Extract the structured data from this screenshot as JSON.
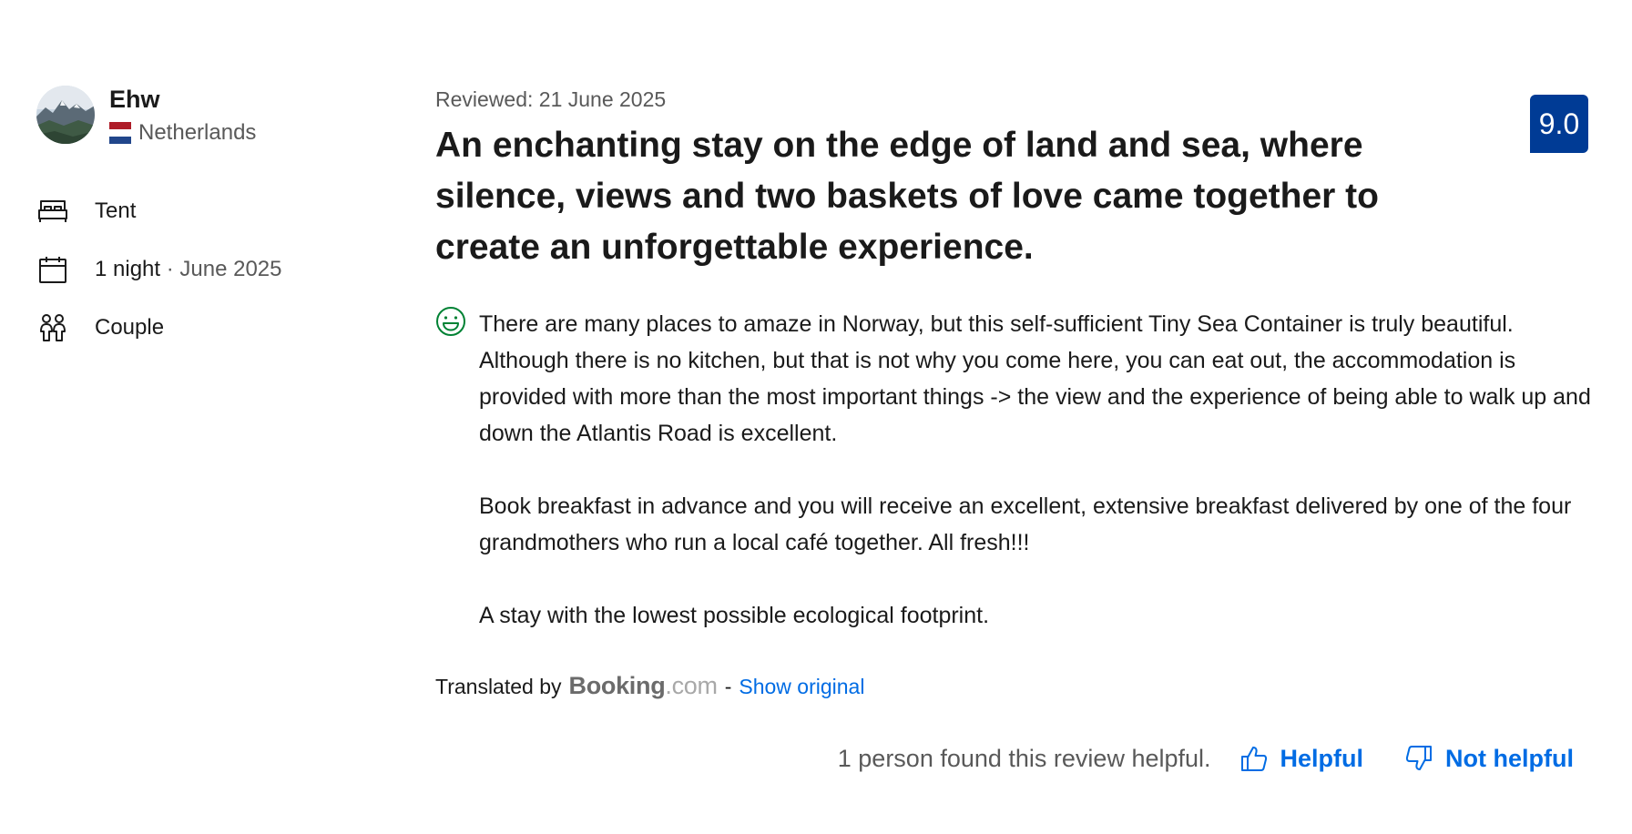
{
  "reviewer": {
    "name": "Ehw",
    "country": "Netherlands",
    "flag_colors": [
      "#ae1c28",
      "#ffffff",
      "#21468b"
    ],
    "avatar_icon": "mountain-landscape-photo"
  },
  "stay_details": [
    {
      "icon": "bed-icon",
      "main": "Tent",
      "sub": ""
    },
    {
      "icon": "calendar-icon",
      "main": "1 night",
      "sub": " · June 2025"
    },
    {
      "icon": "people-icon",
      "main": "Couple",
      "sub": ""
    }
  ],
  "review": {
    "date": "Reviewed: 21 June 2025",
    "title": "An enchanting stay on the edge of land and sea, where silence, views and two baskets of love came together to create an unforgettable experience.",
    "score": "9.0",
    "score_color": "#003b95",
    "sentiment_icon": "smile-icon",
    "sentiment_color": "#008234",
    "paragraphs": [
      "There are many places to amaze in Norway, but this self-sufficient Tiny Sea Container is truly beautiful. Although there is no kitchen, but that is not why you come here, you can eat out, the accommodation is provided with more than the most important things -> the view and the experience of being able to walk up and down the Atlantis Road is excellent.",
      "Book breakfast in advance and you will receive an excellent, extensive breakfast delivered by one of the four grandmothers who run a local café together. All fresh!!!",
      "A stay with the lowest possible ecological footprint."
    ]
  },
  "translation": {
    "prefix": "Translated by",
    "logo_main": "Booking",
    "logo_suffix": ".com",
    "separator": "-",
    "show_original_label": "Show original",
    "link_color": "#006ce4"
  },
  "helpful": {
    "count_text": "1 person found this review helpful.",
    "helpful_label": "Helpful",
    "not_helpful_label": "Not helpful"
  }
}
